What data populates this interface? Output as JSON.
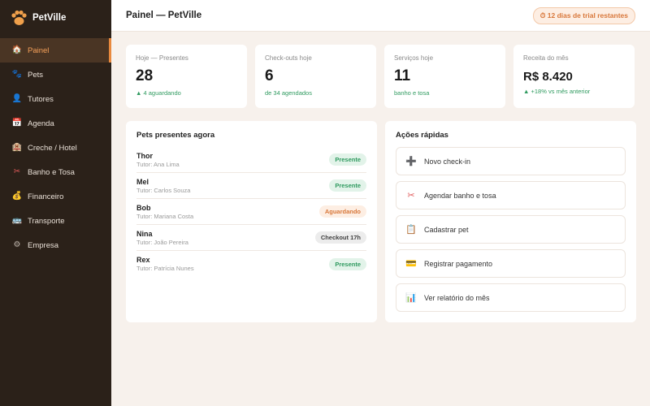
{
  "app": {
    "name": "PetVille"
  },
  "sidebar": {
    "items": [
      {
        "label": "Painel",
        "icon": "home-icon",
        "glyph": "🏠",
        "active": true
      },
      {
        "label": "Pets",
        "icon": "paw-icon",
        "glyph": "🐾"
      },
      {
        "label": "Tutores",
        "icon": "user-icon",
        "glyph": "👤"
      },
      {
        "label": "Agenda",
        "icon": "calendar-icon",
        "glyph": "📅"
      },
      {
        "label": "Creche / Hotel",
        "icon": "hotel-icon",
        "glyph": "🏨"
      },
      {
        "label": "Banho e Tosa",
        "icon": "scissors-icon",
        "glyph": "✂"
      },
      {
        "label": "Financeiro",
        "icon": "money-bag-icon",
        "glyph": "💰"
      },
      {
        "label": "Transporte",
        "icon": "bus-icon",
        "glyph": "🚌"
      },
      {
        "label": "Empresa",
        "icon": "gear-icon",
        "glyph": "⚙"
      }
    ]
  },
  "header": {
    "title": "Painel — PetVille",
    "trial": "⏱ 12 dias de trial restantes"
  },
  "stats": [
    {
      "label": "Hoje — Presentes",
      "value": "28",
      "sub": "▲ 4 aguardando"
    },
    {
      "label": "Check-outs hoje",
      "value": "6",
      "sub": "de 34 agendados"
    },
    {
      "label": "Serviços hoje",
      "value": "11",
      "sub": "banho e tosa"
    },
    {
      "label": "Receita do mês",
      "value": "R$ 8.420",
      "sub": "▲ +18% vs mês anterior"
    }
  ],
  "pets_panel": {
    "title": "Pets presentes agora",
    "pets": [
      {
        "name": "Thor",
        "tutor": "Tutor: Ana Lima",
        "status": "Presente",
        "kind": "present"
      },
      {
        "name": "Mel",
        "tutor": "Tutor: Carlos Souza",
        "status": "Presente",
        "kind": "present"
      },
      {
        "name": "Bob",
        "tutor": "Tutor: Mariana Costa",
        "status": "Aguardando",
        "kind": "waiting"
      },
      {
        "name": "Nina",
        "tutor": "Tutor: João Pereira",
        "status": "Checkout 17h",
        "kind": "checkout"
      },
      {
        "name": "Rex",
        "tutor": "Tutor: Patrícia Nunes",
        "status": "Presente",
        "kind": "present"
      }
    ]
  },
  "actions_panel": {
    "title": "Ações rápidas",
    "actions": [
      {
        "label": "Novo check-in",
        "icon": "plus-icon",
        "glyph": "➕"
      },
      {
        "label": "Agendar banho e tosa",
        "icon": "scissors-icon",
        "glyph": "✂"
      },
      {
        "label": "Cadastrar pet",
        "icon": "clipboard-icon",
        "glyph": "📋"
      },
      {
        "label": "Registrar pagamento",
        "icon": "credit-card-icon",
        "glyph": "💳"
      },
      {
        "label": "Ver relatório do mês",
        "icon": "bar-chart-icon",
        "glyph": "📊"
      }
    ]
  },
  "colors": {
    "accent": "#e8893e",
    "sidebar_bg": "#2b2119",
    "page_bg": "#f7f1ec",
    "success": "#2f9a5f"
  }
}
